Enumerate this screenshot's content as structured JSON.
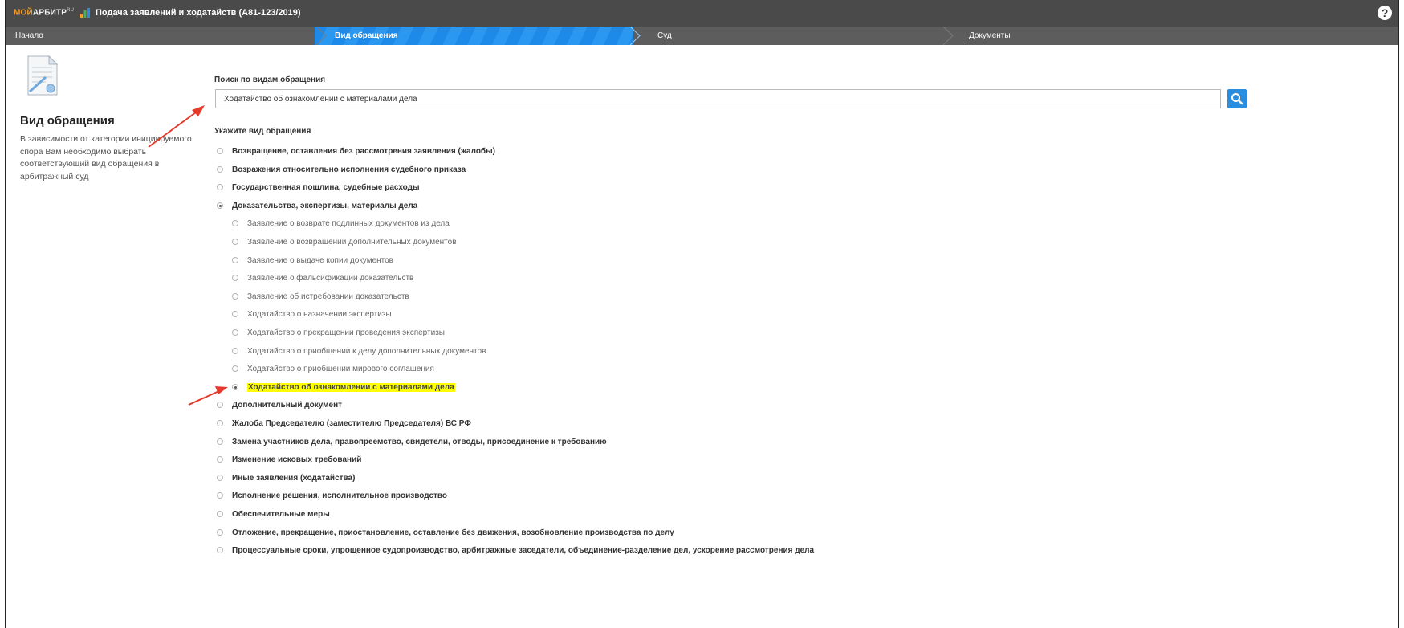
{
  "topbar": {
    "logo_part1": "МОЙ",
    "logo_part2": "АРБИТР",
    "logo_sup": "RU",
    "title": "Подача заявлений и ходатайств  (А81-123/2019)",
    "help": "?"
  },
  "steps": [
    {
      "label": "Начало",
      "active": false
    },
    {
      "label": "Вид обращения",
      "active": true
    },
    {
      "label": "Суд",
      "active": false
    },
    {
      "label": "Документы",
      "active": false
    }
  ],
  "sidebar": {
    "title": "Вид обращения",
    "description": "В зависимости от категории инициируемого спора Вам необходимо выбрать соответствующий вид обращения в арбитражный суд"
  },
  "search": {
    "label": "Поиск по видам обращения",
    "value": "Ходатайство об ознакомлении с материалами дела",
    "placeholder": ""
  },
  "choose_label": "Укажите вид обращения",
  "options": [
    {
      "label": "Возвращение, оставления без рассмотрения заявления (жалобы)",
      "level": 1,
      "selected": false
    },
    {
      "label": "Возражения относительно исполнения судебного приказа",
      "level": 1,
      "selected": false
    },
    {
      "label": "Государственная пошлина, судебные расходы",
      "level": 1,
      "selected": false
    },
    {
      "label": "Доказательства, экспертизы, материалы дела",
      "level": 1,
      "selected": true
    },
    {
      "label": "Заявление о возврате подлинных документов из дела",
      "level": 2,
      "selected": false
    },
    {
      "label": "Заявление о возвращении дополнительных документов",
      "level": 2,
      "selected": false
    },
    {
      "label": "Заявление о выдаче копии документов",
      "level": 2,
      "selected": false
    },
    {
      "label": "Заявление о фальсификации доказательств",
      "level": 2,
      "selected": false
    },
    {
      "label": "Заявление об истребовании доказательств",
      "level": 2,
      "selected": false
    },
    {
      "label": "Ходатайство о назначении экспертизы",
      "level": 2,
      "selected": false
    },
    {
      "label": "Ходатайство о прекращении проведения экспертизы",
      "level": 2,
      "selected": false
    },
    {
      "label": "Ходатайство о приобщении к делу дополнительных документов",
      "level": 2,
      "selected": false
    },
    {
      "label": "Ходатайство о приобщении мирового соглашения",
      "level": 2,
      "selected": false
    },
    {
      "label": "Ходатайство об ознакомлении с материалами дела",
      "level": 2,
      "selected": true,
      "highlighted": true
    },
    {
      "label": "Дополнительный документ",
      "level": 1,
      "selected": false
    },
    {
      "label": "Жалоба Председателю (заместителю Председателя) ВС РФ",
      "level": 1,
      "selected": false
    },
    {
      "label": "Замена участников дела, правопреемство, свидетели, отводы, присоединение к требованию",
      "level": 1,
      "selected": false
    },
    {
      "label": "Изменение исковых требований",
      "level": 1,
      "selected": false
    },
    {
      "label": "Иные заявления (ходатайства)",
      "level": 1,
      "selected": false
    },
    {
      "label": "Исполнение решения, исполнительное производство",
      "level": 1,
      "selected": false
    },
    {
      "label": "Обеспечительные меры",
      "level": 1,
      "selected": false
    },
    {
      "label": "Отложение, прекращение, приостановление, оставление без движения, возобновление производства по делу",
      "level": 1,
      "selected": false
    },
    {
      "label": "Процессуальные сроки, упрощенное судопроизводство, арбитражные заседатели, объединение-разделение дел, ускорение рассмотрения дела",
      "level": 1,
      "selected": false
    }
  ],
  "colors": {
    "topbar": "#4a4a4a",
    "stepbar": "#5d5d5d",
    "active_step": "#2a8ee0",
    "highlight": "#ffff00",
    "annotation_arrow": "#e53a2a"
  }
}
